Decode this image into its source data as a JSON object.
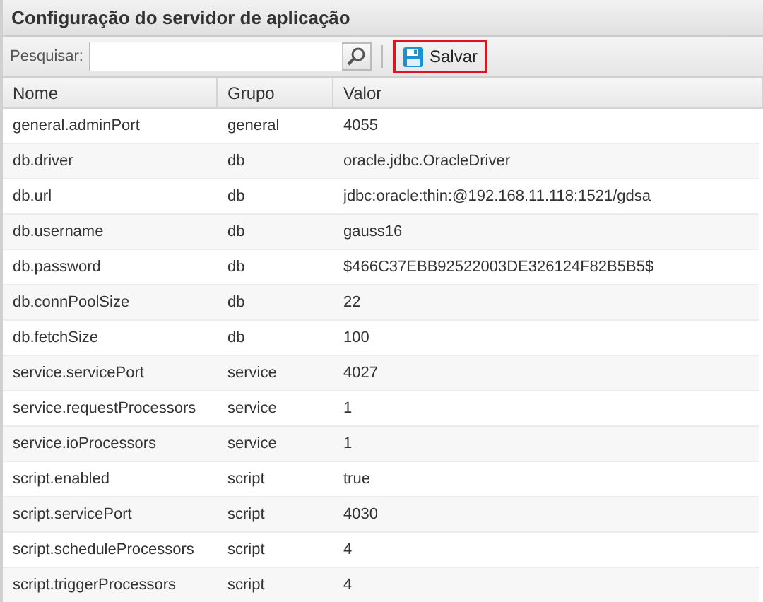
{
  "panel": {
    "title": "Configuração do servidor de aplicação"
  },
  "toolbar": {
    "search_label": "Pesquisar:",
    "save_button": "Salvar"
  },
  "table": {
    "columns": [
      "Nome",
      "Grupo",
      "Valor"
    ],
    "rows": [
      [
        "general.adminPort",
        "general",
        "4055"
      ],
      [
        "db.driver",
        "db",
        "oracle.jdbc.OracleDriver"
      ],
      [
        "db.url",
        "db",
        "jdbc:oracle:thin:@192.168.11.118:1521/gdsa"
      ],
      [
        "db.username",
        "db",
        "gauss16"
      ],
      [
        "db.password",
        "db",
        "$466C37EBB92522003DE326124F82B5B5$"
      ],
      [
        "db.connPoolSize",
        "db",
        "22"
      ],
      [
        "db.fetchSize",
        "db",
        "100"
      ],
      [
        "service.servicePort",
        "service",
        "4027"
      ],
      [
        "service.requestProcessors",
        "service",
        "1"
      ],
      [
        "service.ioProcessors",
        "service",
        "1"
      ],
      [
        "script.enabled",
        "script",
        "true"
      ],
      [
        "script.servicePort",
        "script",
        "4030"
      ],
      [
        "script.scheduleProcessors",
        "script",
        "4"
      ],
      [
        "script.triggerProcessors",
        "script",
        "4"
      ]
    ]
  }
}
